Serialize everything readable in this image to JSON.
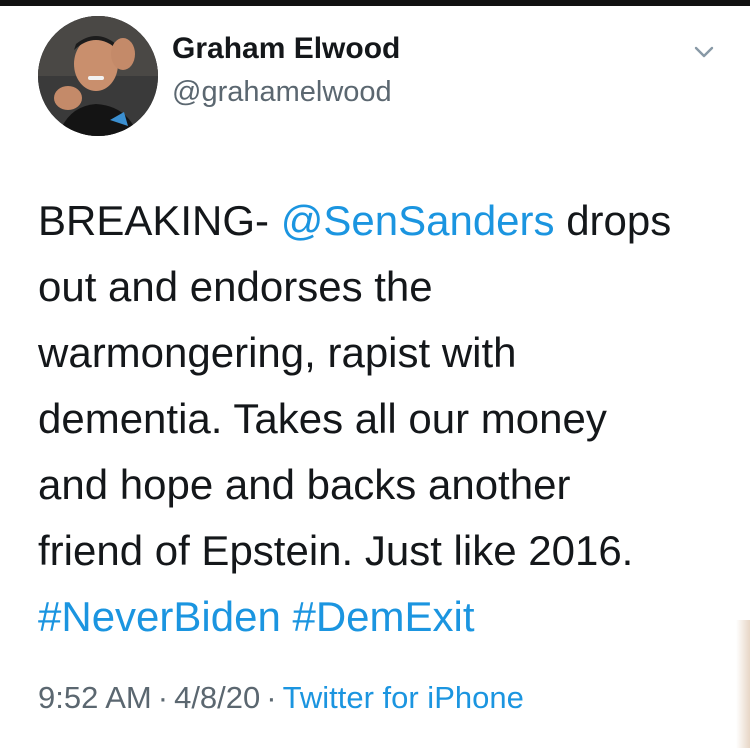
{
  "author": {
    "name": "Graham Elwood",
    "handle": "@grahamelwood"
  },
  "tweet": {
    "line1_prefix": "BREAKING- ",
    "mention": "@SenSanders",
    "line1_suffix": " drops",
    "line2": "out and endorses the",
    "line3": "warmongering, rapist with",
    "line4": "dementia. Takes all our money",
    "line5": "and hope and backs another",
    "line6": "friend of Epstein. Just like 2016.",
    "hashtag1": "#NeverBiden",
    "hashtag2": "#DemExit"
  },
  "meta": {
    "time": "9:52 AM",
    "date": "4/8/20",
    "separator": "·",
    "source": "Twitter for iPhone"
  },
  "colors": {
    "link": "#1b95e0",
    "text": "#14171a",
    "muted": "#5b6770"
  },
  "icons": {
    "menu": "chevron-down-icon"
  }
}
